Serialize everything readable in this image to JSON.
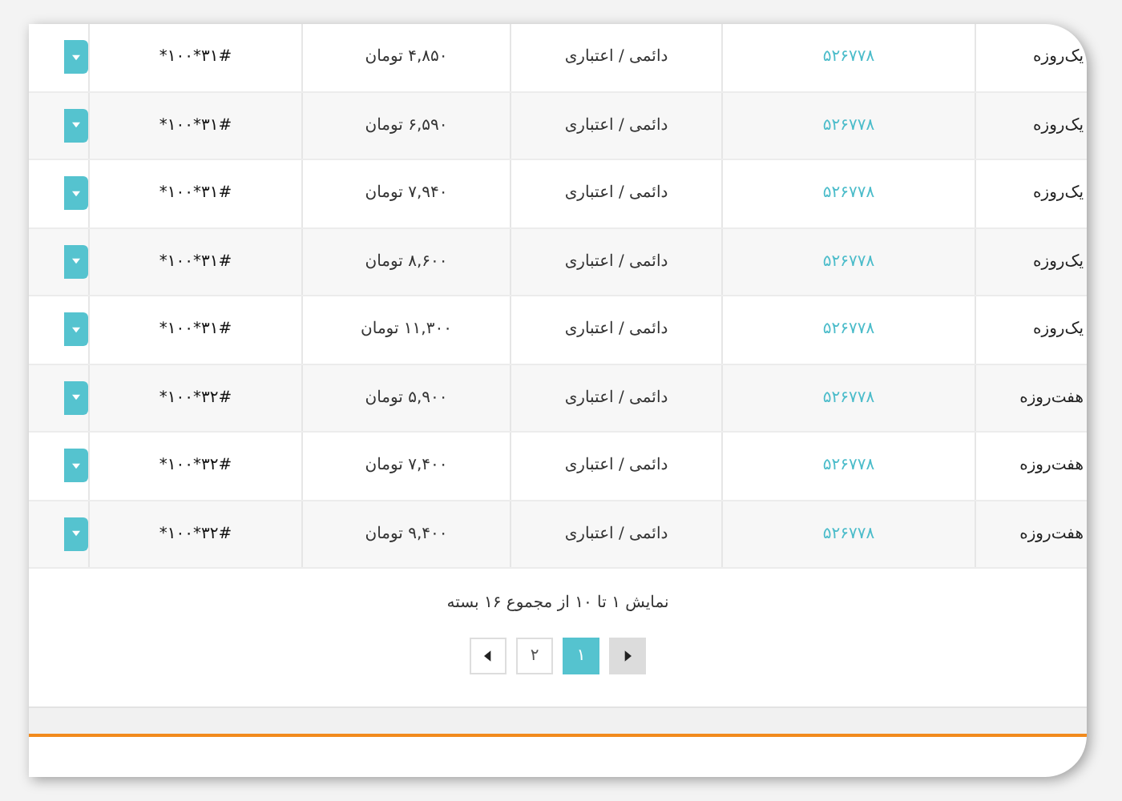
{
  "table": {
    "rows": [
      {
        "name": "یک‌روزه",
        "number": "۵۲۶۷۷۸",
        "type": "دائمی / اعتباری",
        "price": "۴,۸۵۰ تومان",
        "code": "*۱۰۰*۳۱#"
      },
      {
        "name": "یک‌روزه",
        "number": "۵۲۶۷۷۸",
        "type": "دائمی / اعتباری",
        "price": "۶,۵۹۰ تومان",
        "code": "*۱۰۰*۳۱#"
      },
      {
        "name": "یک‌روزه",
        "number": "۵۲۶۷۷۸",
        "type": "دائمی / اعتباری",
        "price": "۷,۹۴۰ تومان",
        "code": "*۱۰۰*۳۱#"
      },
      {
        "name": "یک‌روزه",
        "number": "۵۲۶۷۷۸",
        "type": "دائمی / اعتباری",
        "price": "۸,۶۰۰ تومان",
        "code": "*۱۰۰*۳۱#"
      },
      {
        "name": "یک‌روزه",
        "number": "۵۲۶۷۷۸",
        "type": "دائمی / اعتباری",
        "price": "۱۱,۳۰۰ تومان",
        "code": "*۱۰۰*۳۱#"
      },
      {
        "name": "هفت‌روزه",
        "number": "۵۲۶۷۷۸",
        "type": "دائمی / اعتباری",
        "price": "۵,۹۰۰ تومان",
        "code": "*۱۰۰*۳۲#"
      },
      {
        "name": "هفت‌روزه",
        "number": "۵۲۶۷۷۸",
        "type": "دائمی / اعتباری",
        "price": "۷,۴۰۰ تومان",
        "code": "*۱۰۰*۳۲#"
      },
      {
        "name": "هفت‌روزه",
        "number": "۵۲۶۷۷۸",
        "type": "دائمی / اعتباری",
        "price": "۹,۴۰۰ تومان",
        "code": "*۱۰۰*۳۲#"
      }
    ]
  },
  "summary": "نمایش ۱ تا ۱۰ از مجموع ۱۶ بسته",
  "pagination": {
    "next": {
      "disabled": true
    },
    "pages": [
      {
        "label": "۱",
        "selected": true
      },
      {
        "label": "۲",
        "selected": false
      }
    ],
    "prev": {
      "disabled": false
    }
  }
}
